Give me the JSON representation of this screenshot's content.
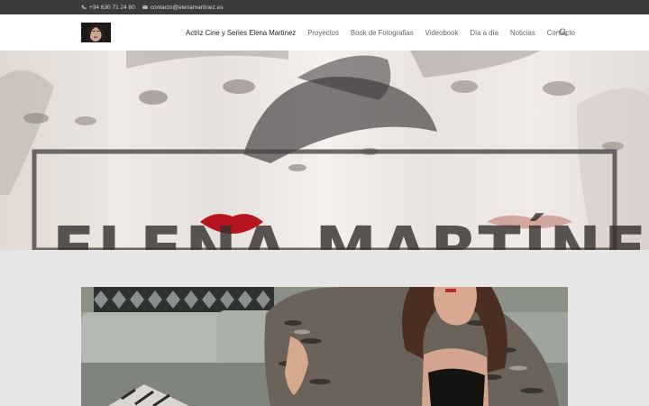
{
  "topbar": {
    "phone": "+34 630 71 24 80",
    "email": "contacto@elenamartinez.es",
    "phone_icon": "phone-icon",
    "email_icon": "envelope-icon"
  },
  "nav": {
    "items": [
      {
        "label": "Actriz Cine y Series Elena Martinez",
        "active": true
      },
      {
        "label": "Proyectos"
      },
      {
        "label": "Book de Fotografias"
      },
      {
        "label": "Videobook"
      },
      {
        "label": "Día a día"
      },
      {
        "label": "Noticias"
      },
      {
        "label": "Contacto"
      }
    ],
    "search_icon": "search-icon"
  },
  "hero": {
    "title": "ELENA MARTÍNEZ"
  },
  "colors": {
    "topbar": "#3b3b3b",
    "header": "#ffffff",
    "page_bg": "#e6e6e6",
    "lips": "#b8141f"
  }
}
